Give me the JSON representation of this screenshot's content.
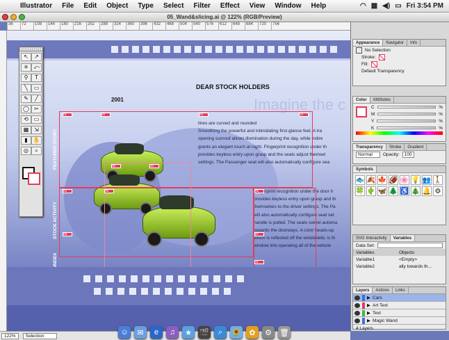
{
  "menubar": {
    "app": "Illustrator",
    "menus": [
      "File",
      "Edit",
      "Object",
      "Type",
      "Select",
      "Filter",
      "Effect",
      "View",
      "Window",
      "Help"
    ],
    "clock": "Fri 3:54 PM"
  },
  "window": {
    "title": "05_Wand&slicing.ai @ 122% (RGB/Preview)"
  },
  "ruler": {
    "ticks": [
      "36",
      "72",
      "108",
      "144",
      "180",
      "216",
      "252",
      "288",
      "324",
      "360",
      "396",
      "432",
      "468",
      "504",
      "540",
      "576",
      "612",
      "648",
      "684",
      "720",
      "756"
    ]
  },
  "artboard": {
    "heading": "DEAR STOCK HOLDERS",
    "year": "2001",
    "tagline": "Imagine the c",
    "body1": [
      "lines are curved and rounded",
      "Smoothing the powerful and intimidating first-glance feel. A tra",
      "opening sunroof allows illumination during the day, while indire",
      "grants an elegant touch at night. Fingerprint recognition under th",
      "provides keyless entry upon grasp and the seats adjust themsel",
      "settings. The Passenger seat will also automatically configure sea"
    ],
    "body2": [
      "Fingerprint recognition under the door h",
      "provides keyless entry upon grasp and th",
      "themselves to the driver settings. The Pa",
      "will also automatically configure seat set",
      "handle is pulled. The seats swivel automa",
      "towards the doorways. A color heads-up",
      "which is reflected off the windshield, is th",
      "window into operating all of the vehicle"
    ],
    "vertical1": "FEATURED STORY",
    "vertical2": "STOCK ACTIVITY",
    "vertical3": "100%INDEX",
    "slice_labels": [
      "01",
      "02",
      "03",
      "04",
      "05",
      "06",
      "07",
      "08",
      "09",
      "10",
      "11",
      "12"
    ],
    "colors": {
      "guide": "#e23b5b",
      "band": "#5f6bb6",
      "car": "#a6d93a"
    }
  },
  "panels": {
    "appearance": {
      "tabs": [
        "Appearance",
        "Navigator",
        "Info"
      ],
      "selection": "No Selection",
      "stroke": "Stroke:",
      "fill": "Fill:",
      "default": "Default Transparency"
    },
    "color": {
      "tabs": [
        "Color",
        "Attributes"
      ],
      "channels": [
        "C",
        "M",
        "Y",
        "K"
      ]
    },
    "transparency": {
      "tabs": [
        "Transparency",
        "Stroke",
        "Gradient"
      ],
      "mode": "Normal",
      "opacity_label": "Opacity:",
      "opacity": "100"
    },
    "symbols": {
      "tabs": [
        "Symbols"
      ],
      "items": [
        "🐟",
        "🍂",
        "🍁",
        "🏈",
        "🌸",
        "💡",
        "👥",
        "🚶",
        "🍀",
        "🌵",
        "🦋",
        "🌲",
        "♿",
        "🎄",
        "🔔",
        "⚙"
      ]
    },
    "variables": {
      "tabs": [
        "SVG Interactivity",
        "Variables"
      ],
      "dataset": "Data Set:",
      "headers": [
        "Variables",
        "Objects"
      ],
      "rows": [
        {
          "name": "Variable1",
          "object": "<Empty>"
        },
        {
          "name": "Variable2",
          "object": "ally towards th..."
        }
      ]
    },
    "layers": {
      "tabs": [
        "Layers",
        "Actions",
        "Links"
      ],
      "items": [
        {
          "name": "Cars",
          "color": "#3b6fe0"
        },
        {
          "name": "Art Text",
          "color": "#e23b5b"
        },
        {
          "name": "Text",
          "color": "#3bbb4a"
        },
        {
          "name": "Magic Wand",
          "color": "#3b6fe0"
        }
      ],
      "footer": "4 Layers"
    }
  },
  "status": {
    "zoom": "122%",
    "tool": "Selection"
  },
  "dock": {
    "apps": [
      "finder-icon",
      "mail-icon",
      "ie-icon",
      "itunes-icon",
      "imovie-icon",
      "clapper-icon",
      "search-icon",
      "iphoto-icon",
      "illustrator-icon",
      "system-prefs-icon",
      "trash-icon"
    ]
  }
}
